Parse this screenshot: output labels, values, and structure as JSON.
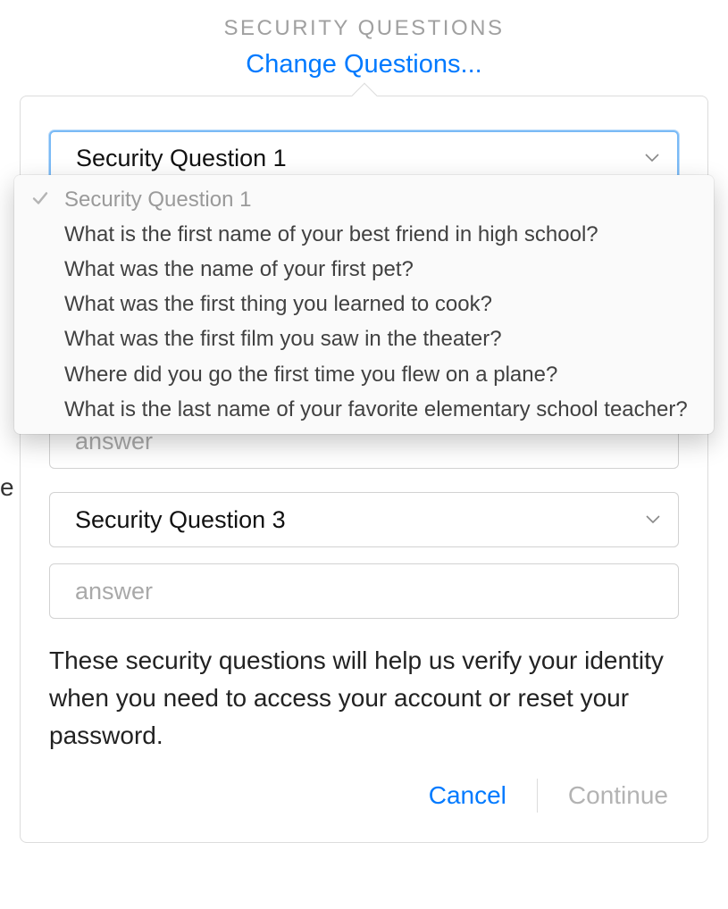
{
  "header": {
    "title": "SECURITY QUESTIONS",
    "change_link": "Change Questions..."
  },
  "dropdown": {
    "selected_label": "Security Question 1",
    "options": [
      "What is the first name of your best friend in high school?",
      "What was the name of your first pet?",
      "What was the first thing you learned to cook?",
      "What was the first film you saw in the theater?",
      "Where did you go the first time you flew on a plane?",
      "What is the last name of your favorite elementary school teacher?"
    ]
  },
  "fields": {
    "q1_label": "Security Question 1",
    "q2_answer_placeholder": "answer",
    "q3_label": "Security Question 3",
    "q3_answer_placeholder": "answer"
  },
  "help_text": "These security questions will help us verify your identity when you need to access your account or reset your password.",
  "buttons": {
    "cancel": "Cancel",
    "continue": "Continue"
  },
  "left_fragment": "e",
  "colors": {
    "accent": "#007aff",
    "border": "#d2d2d2",
    "muted_text": "#a0a0a0"
  }
}
